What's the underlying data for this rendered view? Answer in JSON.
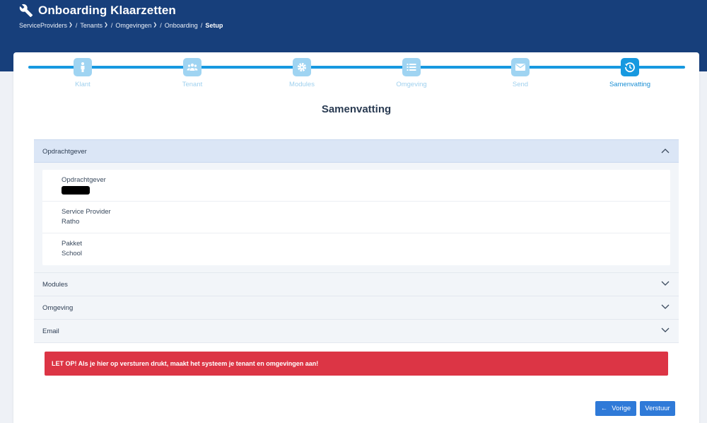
{
  "header": {
    "title": "Onboarding Klaarzetten",
    "breadcrumb": [
      {
        "label": "ServiceProviders",
        "dropdown": true
      },
      {
        "label": "Tenants",
        "dropdown": true
      },
      {
        "label": "Omgevingen",
        "dropdown": true
      },
      {
        "label": "Onboarding",
        "dropdown": false
      },
      {
        "label": "Setup",
        "current": true
      }
    ],
    "separator": "/"
  },
  "stepper": {
    "steps": [
      {
        "label": "Klant",
        "icon": "person-icon"
      },
      {
        "label": "Tenant",
        "icon": "users-icon"
      },
      {
        "label": "Modules",
        "icon": "gear-icon"
      },
      {
        "label": "Omgeving",
        "icon": "list-icon"
      },
      {
        "label": "Send",
        "icon": "envelope-icon"
      },
      {
        "label": "Samenvatting",
        "icon": "history-icon",
        "active": true
      }
    ]
  },
  "page_title": "Samenvatting",
  "accordion": {
    "opdrachtgever": {
      "title": "Opdrachtgever",
      "expanded": true,
      "items": [
        {
          "label": "Opdrachtgever",
          "value": "",
          "redacted": true
        },
        {
          "label": "Service Provider",
          "value": "Ratho"
        },
        {
          "label": "Pakket",
          "value": "School"
        }
      ]
    },
    "modules": {
      "title": "Modules",
      "expanded": false
    },
    "omgeving": {
      "title": "Omgeving",
      "expanded": false
    },
    "email": {
      "title": "Email",
      "expanded": false
    }
  },
  "alert": {
    "text": "LET OP! Als je hier op versturen drukt, maakt het systeem je tenant en omgevingen aan!"
  },
  "buttons": {
    "prev": "Vorige",
    "prev_arrow": "←",
    "send": "Verstuur"
  },
  "colors": {
    "header": "#173f7b",
    "accent": "#1799e0",
    "alert": "#dc3545",
    "button": "#2f7ad8"
  }
}
